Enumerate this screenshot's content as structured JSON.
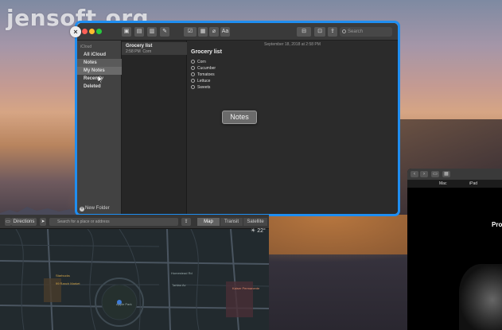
{
  "watermark": "jensoft.org",
  "notes_window": {
    "close_glyph": "×",
    "traffic_lights": {
      "red": "#fc5f57",
      "yellow": "#fdbc2e",
      "green": "#28c840"
    },
    "toolbar_icons": [
      "sidebar-icon",
      "list-icon",
      "trash-icon",
      "compose-icon",
      "checklist-icon",
      "table-icon",
      "attachment-icon",
      "format-icon",
      "lock-icon",
      "share-icon"
    ],
    "format_label": "Aa",
    "search_placeholder": "Search",
    "sidebar": {
      "header": "iCloud",
      "items": [
        {
          "label": "All iCloud",
          "selected": false
        },
        {
          "label": "Notes",
          "selected": true
        },
        {
          "label": "My Notes",
          "selected": true
        },
        {
          "label": "Recently Deleted",
          "selected": false
        }
      ],
      "new_folder_label": "New Folder"
    },
    "note_list": [
      {
        "title": "Grocery list",
        "time": "2:58 PM",
        "preview": "Corn"
      }
    ],
    "editor": {
      "date": "September 18, 2018 at 2:58 PM",
      "title": "Grocery list",
      "items": [
        "Corn",
        "Cucumber",
        "Tomatoes",
        "Lettuce",
        "Sweets"
      ]
    },
    "accent": "#1f8ef1"
  },
  "tooltip": "Notes",
  "maps_window": {
    "directions_label": "Directions",
    "search_placeholder": "Search for a place or address",
    "segments": [
      {
        "label": "Map",
        "selected": true
      },
      {
        "label": "Transit",
        "selected": false
      },
      {
        "label": "Satellite",
        "selected": false
      }
    ],
    "temperature": "☀ 22°",
    "labels": [
      "Apple Park",
      "Starbucks",
      "99 Ranch Market",
      "Homestead Rd",
      "Tantau Av",
      "Kaiser Permanente"
    ]
  },
  "safari_window": {
    "nav_items": [
      "Mac",
      "iPad"
    ],
    "headline": "Pro"
  }
}
